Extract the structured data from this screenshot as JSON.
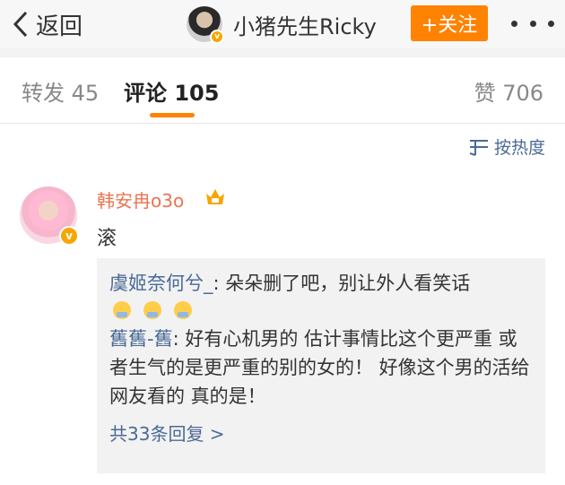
{
  "header": {
    "back_label": "返回",
    "user_name": "小猪先生Ricky",
    "follow_label": "+关注"
  },
  "tabs": {
    "repost_label": "转发 45",
    "comment_label": "评论 105",
    "like_label": "赞 706"
  },
  "sort": {
    "label": "按热度"
  },
  "comment": {
    "author": "韩安冉o3o",
    "text": "滚",
    "replies": [
      {
        "author": "虞姬奈何兮_",
        "separator": ":",
        "text": " 朵朵删了吧，别让外人看笑话"
      },
      {
        "author": "舊舊-舊",
        "separator": ":",
        "text": " 好有心机男的 估计事情比这个更严重 或者生气的是更严重的别的女的！ 好像这个男的活给网友看的 真的是！"
      }
    ],
    "emoji_count": 3,
    "more_replies_label": "共33条回复 >"
  },
  "colors": {
    "accent": "#ff8200",
    "link": "#4a6a96",
    "name_orange": "#eb7350"
  },
  "icons": [
    "chevron-left-icon",
    "more-dots-icon",
    "sort-icon",
    "crown-badge-icon",
    "verified-icon",
    "emoji-icon"
  ]
}
